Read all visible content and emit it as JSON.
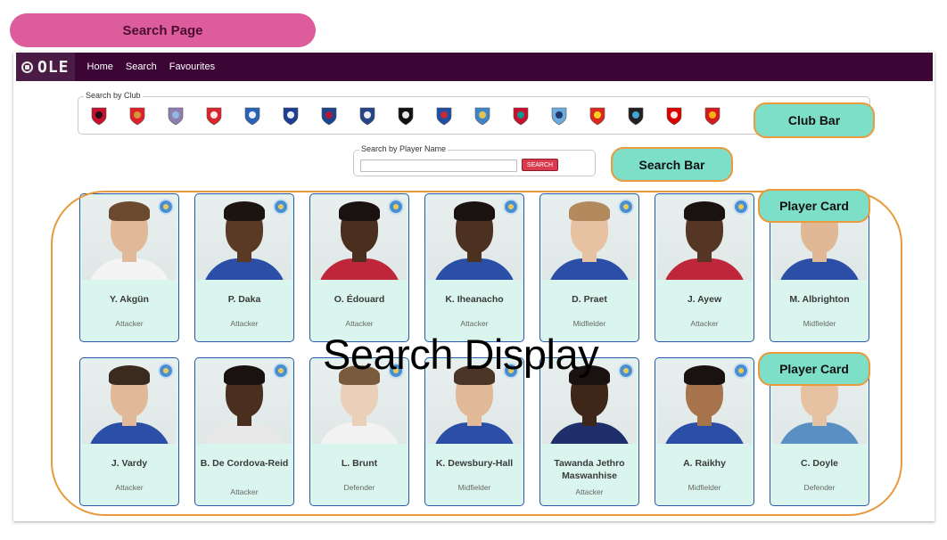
{
  "annotations": {
    "page_title": "Search Page",
    "club_bar": "Club Bar",
    "search_bar": "Search Bar",
    "player_card": "Player Card",
    "search_display": "Search Display"
  },
  "nav": {
    "logo_text": "OLE",
    "links": [
      "Home",
      "Search",
      "Favourites"
    ]
  },
  "club_filter": {
    "legend": "Search by Club",
    "clubs": [
      {
        "icon": "bournemouth-crest-icon",
        "color": "#c8102e",
        "accent": "#111111"
      },
      {
        "icon": "arsenal-crest-icon",
        "color": "#e0202b",
        "accent": "#d4a33a"
      },
      {
        "icon": "aston-villa-crest-icon",
        "color": "#8e7fb0",
        "accent": "#95bfe5"
      },
      {
        "icon": "brentford-crest-icon",
        "color": "#d9262b",
        "accent": "#ffffff"
      },
      {
        "icon": "brighton-crest-icon",
        "color": "#2a62b8",
        "accent": "#ffffff"
      },
      {
        "icon": "chelsea-crest-icon",
        "color": "#1c3f94",
        "accent": "#ffffff"
      },
      {
        "icon": "crystal-palace-crest-icon",
        "color": "#1b458f",
        "accent": "#c4122e"
      },
      {
        "icon": "everton-crest-icon",
        "color": "#274488",
        "accent": "#ffffff"
      },
      {
        "icon": "fulham-crest-icon",
        "color": "#111111",
        "accent": "#ffffff"
      },
      {
        "icon": "ipswich-crest-icon",
        "color": "#1f4fa0",
        "accent": "#d8262f"
      },
      {
        "icon": "leicester-crest-icon",
        "color": "#3f86c9",
        "accent": "#f0c94a"
      },
      {
        "icon": "liverpool-crest-icon",
        "color": "#c8102e",
        "accent": "#00a398"
      },
      {
        "icon": "man-city-crest-icon",
        "color": "#6cabdd",
        "accent": "#1c2c5b"
      },
      {
        "icon": "man-united-crest-icon",
        "color": "#da291c",
        "accent": "#fbe122"
      },
      {
        "icon": "newcastle-crest-icon",
        "color": "#241f20",
        "accent": "#41b6e6"
      },
      {
        "icon": "nottingham-forest-crest-icon",
        "color": "#dd0000",
        "accent": "#ffffff"
      },
      {
        "icon": "southampton-crest-icon",
        "color": "#d71920",
        "accent": "#ffc20e"
      }
    ]
  },
  "player_search": {
    "legend": "Search by Player Name",
    "input_value": "",
    "input_placeholder": "",
    "button_label": "SEARCH"
  },
  "players": [
    {
      "name": "Y. Akgün",
      "position": "Attacker",
      "skin": "#e2b998",
      "hair": "#6b4a2f",
      "shirt": "#f4f4f4"
    },
    {
      "name": "P. Daka",
      "position": "Attacker",
      "skin": "#5a3a24",
      "hair": "#1c1410",
      "shirt": "#2b4fa6"
    },
    {
      "name": "O. Édouard",
      "position": "Attacker",
      "skin": "#4a2f1f",
      "hair": "#1a1210",
      "shirt": "#c0263a"
    },
    {
      "name": "K. Iheanacho",
      "position": "Attacker",
      "skin": "#4c3020",
      "hair": "#1a1210",
      "shirt": "#2b4fa6"
    },
    {
      "name": "D. Praet",
      "position": "Midfielder",
      "skin": "#e6c2a3",
      "hair": "#b38a5d",
      "shirt": "#2b4fa6"
    },
    {
      "name": "J. Ayew",
      "position": "Attacker",
      "skin": "#553624",
      "hair": "#1a1210",
      "shirt": "#c0263a"
    },
    {
      "name": "M. Albrighton",
      "position": "Midfielder",
      "skin": "#e0b896",
      "hair": "#6b4a2f",
      "shirt": "#2b4fa6"
    },
    {
      "name": "J. Vardy",
      "position": "Attacker",
      "skin": "#e2b998",
      "hair": "#3b2a1e",
      "shirt": "#2b4fa6"
    },
    {
      "name": "B. De Cordova-Reid",
      "position": "Attacker",
      "skin": "#4a2f1f",
      "hair": "#1a1210",
      "shirt": "#e8e8e8"
    },
    {
      "name": "L. Brunt",
      "position": "Defender",
      "skin": "#ead0b8",
      "hair": "#7a5a3c",
      "shirt": "#f2f2f2"
    },
    {
      "name": "K. Dewsbury-Hall",
      "position": "Midfielder",
      "skin": "#e2b998",
      "hair": "#4a3526",
      "shirt": "#2b4fa6"
    },
    {
      "name": "Tawanda Jethro Maswanhise",
      "position": "Attacker",
      "skin": "#3e2618",
      "hair": "#1a1210",
      "shirt": "#1f2f6b"
    },
    {
      "name": "A. Raikhy",
      "position": "Midfielder",
      "skin": "#a8744e",
      "hair": "#1a1210",
      "shirt": "#2b4fa6"
    },
    {
      "name": "C. Doyle",
      "position": "Defender",
      "skin": "#e6c2a3",
      "hair": "#6b4a2f",
      "shirt": "#5a8fc4"
    }
  ]
}
